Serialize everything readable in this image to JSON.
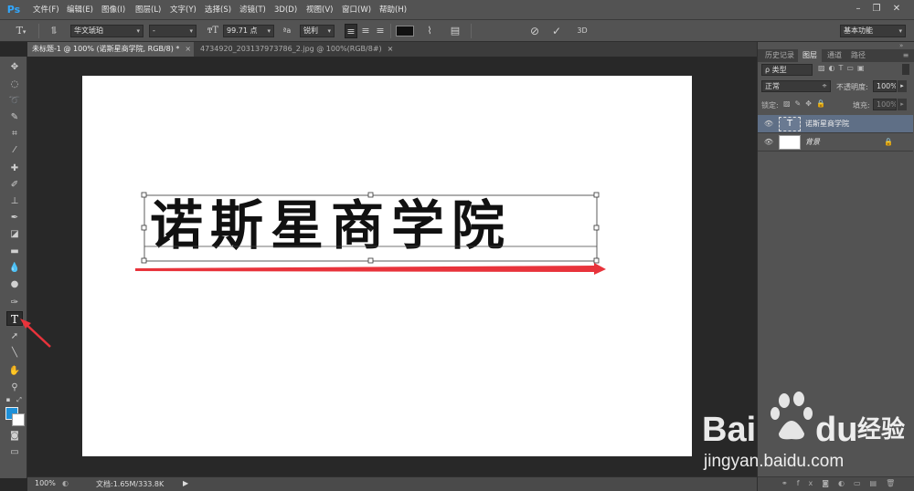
{
  "app": {
    "logo": "Ps"
  },
  "menus": [
    "文件(F)",
    "编辑(E)",
    "图像(I)",
    "图层(L)",
    "文字(Y)",
    "选择(S)",
    "滤镜(T)",
    "3D(D)",
    "视图(V)",
    "窗口(W)",
    "帮助(H)"
  ],
  "window_controls": {
    "minimize": "–",
    "restore": "❐",
    "close": "✕"
  },
  "options": {
    "font_family": "华文琥珀",
    "font_style": "-",
    "font_size": "99.71 点",
    "aa_label": "ªa",
    "antialias": "锐利",
    "workspace": "基本功能",
    "label_3d": "3D",
    "text_color": "#111111"
  },
  "tabs": [
    {
      "label": "未标题-1 @ 100% (诺斯星商学院, RGB/8) *",
      "close": "×"
    },
    {
      "label": "4734920_203137973786_2.jpg @ 100%(RGB/8#)",
      "close": "×"
    }
  ],
  "canvas": {
    "text": "诺斯星商学院"
  },
  "status": {
    "zoom": "100%",
    "doc_info": "文档:1.65M/333.8K"
  },
  "panel": {
    "tabs": [
      "历史记录",
      "图层",
      "通道",
      "路径"
    ],
    "active_tab": "图层",
    "filter_label": "ρ 类型",
    "blend_mode": "正常",
    "opacity_label": "不透明度:",
    "opacity_value": "100%",
    "lock_label": "锁定:",
    "fill_label": "填充:",
    "fill_value": "100%",
    "layers": [
      {
        "name": "诺斯星商学院",
        "type": "text",
        "selected": true
      },
      {
        "name": "背景",
        "type": "background",
        "selected": false
      }
    ]
  },
  "watermark": {
    "brand": "Bai",
    "brand2": "du",
    "cn": "经验",
    "url": "jingyan.baidu.com"
  },
  "colors": {
    "foreground": "#1e90d8",
    "background": "#ffffff",
    "accent_arrow": "#e8333b"
  }
}
